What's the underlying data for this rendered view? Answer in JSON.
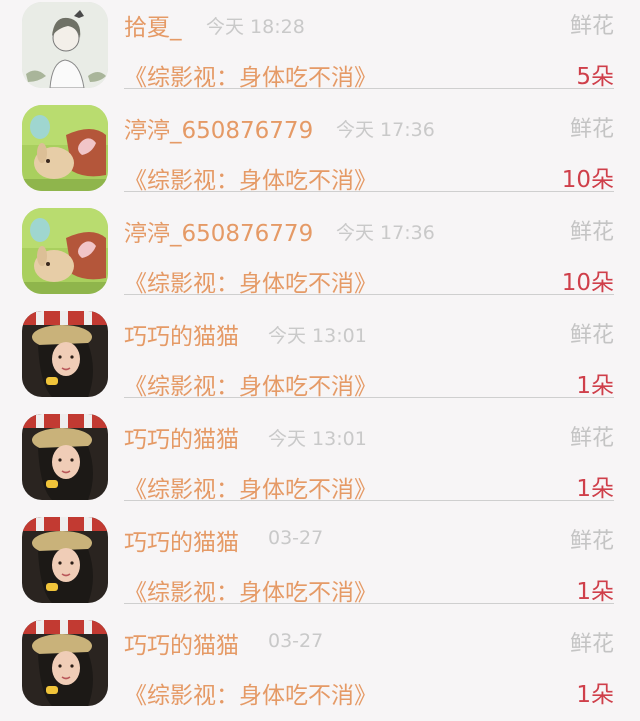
{
  "gift_list": [
    {
      "avatar": "avatar-girl-sketch",
      "user": "拾夏_",
      "time": "今天 18:28",
      "gift": "鲜花",
      "title": "《综影视：身体吃不消》",
      "count": "5朵"
    },
    {
      "avatar": "avatar-rabbit",
      "user": "渟渟_650876779",
      "time": "今天 17:36",
      "gift": "鲜花",
      "title": "《综影视：身体吃不消》",
      "count": "10朵"
    },
    {
      "avatar": "avatar-rabbit",
      "user": "渟渟_650876779",
      "time": "今天 17:36",
      "gift": "鲜花",
      "title": "《综影视：身体吃不消》",
      "count": "10朵"
    },
    {
      "avatar": "avatar-girl-hat",
      "user": "巧巧的猫猫",
      "time": "今天 13:01",
      "gift": "鲜花",
      "title": "《综影视：身体吃不消》",
      "count": "1朵"
    },
    {
      "avatar": "avatar-girl-hat",
      "user": "巧巧的猫猫",
      "time": "今天 13:01",
      "gift": "鲜花",
      "title": "《综影视：身体吃不消》",
      "count": "1朵"
    },
    {
      "avatar": "avatar-girl-hat",
      "user": "巧巧的猫猫",
      "time": "03-27",
      "gift": "鲜花",
      "title": "《综影视：身体吃不消》",
      "count": "1朵"
    },
    {
      "avatar": "avatar-girl-hat",
      "user": "巧巧的猫猫",
      "time": "03-27",
      "gift": "鲜花",
      "title": "《综影视：身体吃不消》",
      "count": "1朵"
    }
  ]
}
